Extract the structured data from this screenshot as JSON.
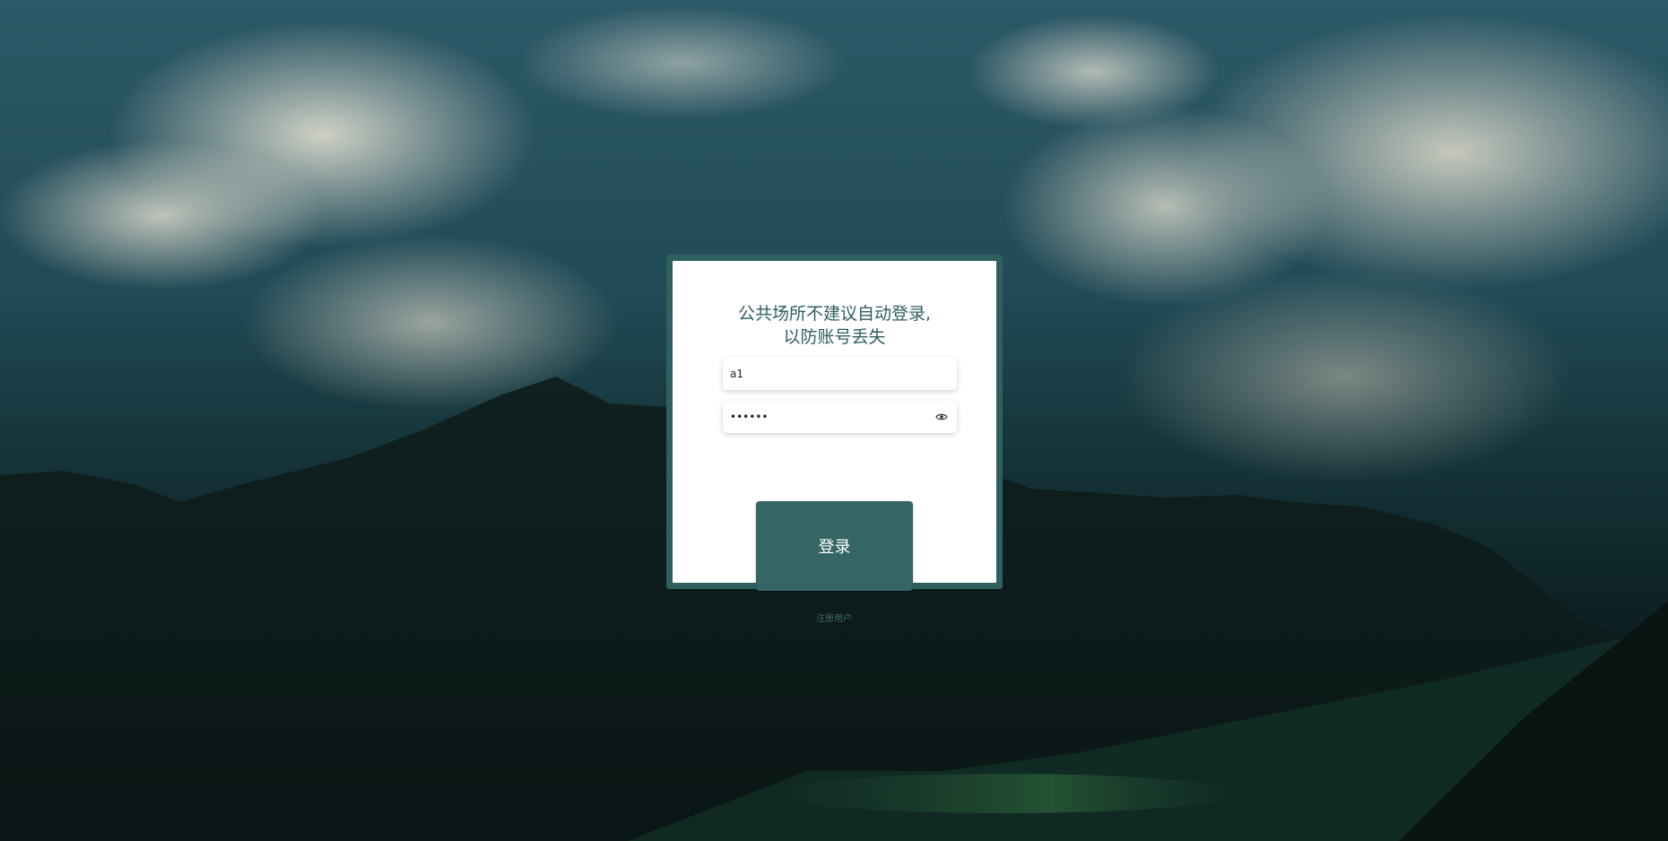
{
  "login": {
    "notice_line1": "公共场所不建议自动登录,",
    "notice_line2": "以防账号丢失",
    "username_value": "a1",
    "password_value": "••••••",
    "submit_label": "登录",
    "register_label": "注册用户"
  },
  "icons": {
    "password_toggle": "eye-icon"
  },
  "colors": {
    "accent": "#2f5f5e",
    "button": "#356564",
    "card_background": "#ffffff",
    "register_link": "#3f6868"
  }
}
